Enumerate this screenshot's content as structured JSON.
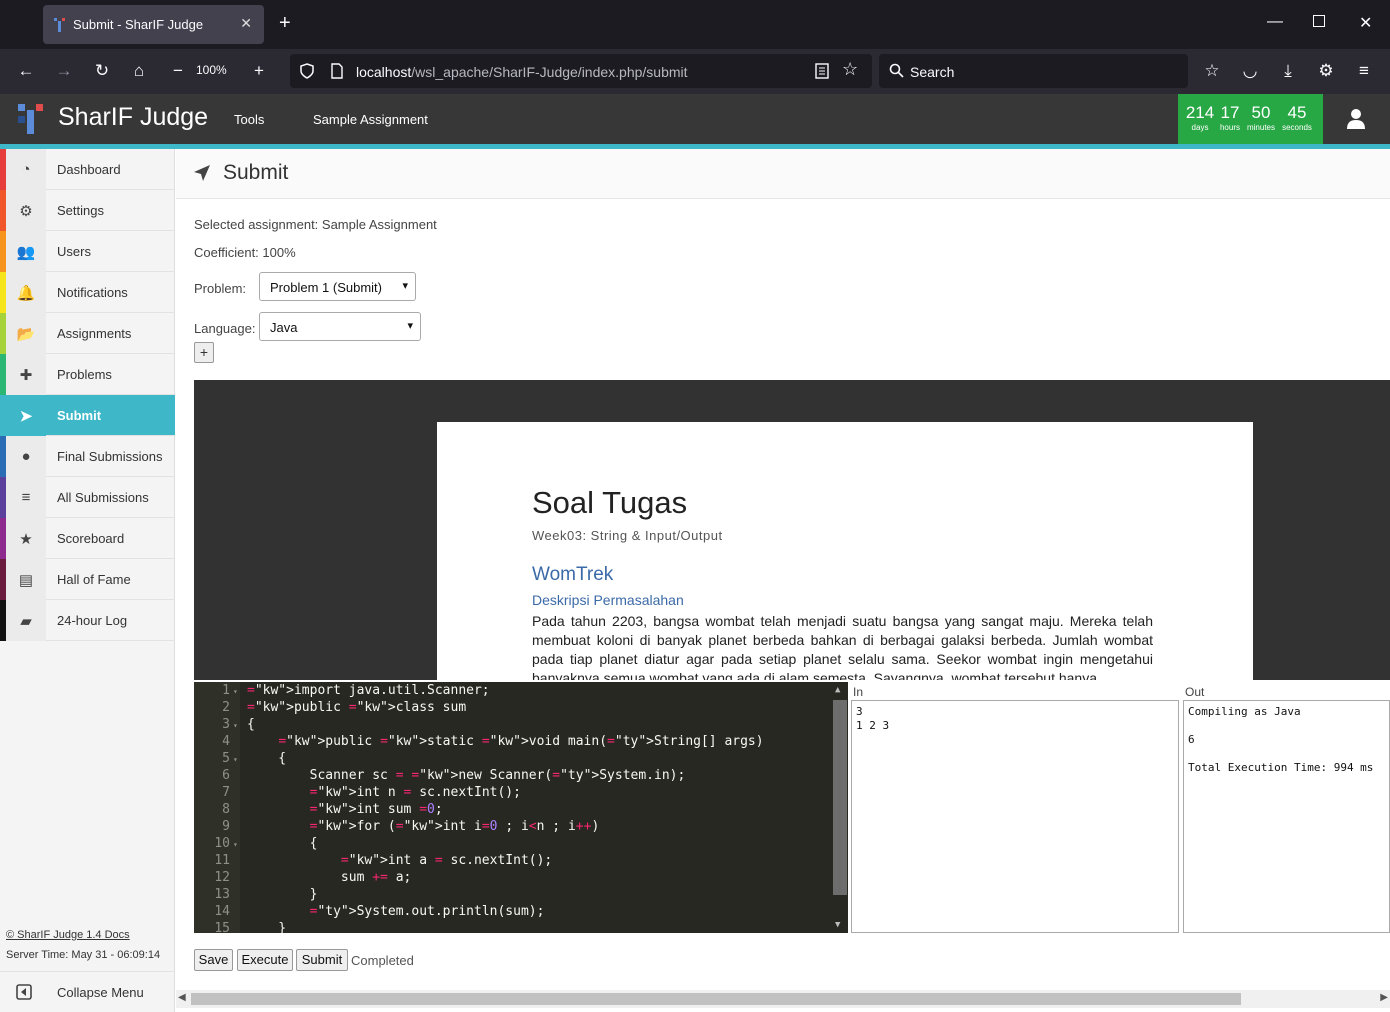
{
  "browser": {
    "tab_title": "Submit - SharIF Judge",
    "zoom": "100%",
    "url_host": "localhost",
    "url_path": "/wsl_apache/SharIF-Judge/index.php/submit",
    "search_placeholder": "Search"
  },
  "header": {
    "brand": "SharIF Judge",
    "nav": [
      "Tools",
      "Sample Assignment"
    ],
    "countdown": [
      {
        "value": "214",
        "unit": "days"
      },
      {
        "value": "17",
        "unit": "hours"
      },
      {
        "value": "50",
        "unit": "minutes"
      },
      {
        "value": "45",
        "unit": "seconds"
      }
    ],
    "accent_color": "#3eb8c9",
    "countdown_color": "#28a745"
  },
  "sidebar": {
    "items": [
      {
        "label": "Dashboard",
        "icon": "dashboard-icon",
        "color": "#e63c3c"
      },
      {
        "label": "Settings",
        "icon": "gear-icon",
        "color": "#f0562a"
      },
      {
        "label": "Users",
        "icon": "users-icon",
        "color": "#f7941d"
      },
      {
        "label": "Notifications",
        "icon": "bell-icon",
        "color": "#f5e51a"
      },
      {
        "label": "Assignments",
        "icon": "folder-icon",
        "color": "#a6d33a"
      },
      {
        "label": "Problems",
        "icon": "puzzle-icon",
        "color": "#2bb673"
      },
      {
        "label": "Submit",
        "icon": "paper-plane-icon",
        "color": "#3eb8c9"
      },
      {
        "label": "Final Submissions",
        "icon": "map-marker-icon",
        "color": "#2a6db5"
      },
      {
        "label": "All Submissions",
        "icon": "list-icon",
        "color": "#5b3f9c"
      },
      {
        "label": "Scoreboard",
        "icon": "star-icon",
        "color": "#8e2a8e"
      },
      {
        "label": "Hall of Fame",
        "icon": "list-alt-icon",
        "color": "#6b1b3c"
      },
      {
        "label": "24-hour Log",
        "icon": "book-icon",
        "color": "#111111"
      }
    ],
    "footer_link": "© SharIF Judge 1.4 Docs",
    "server_time": "Server Time: May 31 - 06:09:14",
    "collapse_label": "Collapse Menu"
  },
  "page": {
    "title": "Submit",
    "selected_assignment": "Selected assignment: Sample Assignment",
    "coefficient": "Coefficient: 100%",
    "problem_label": "Problem:",
    "problem_value": "Problem 1 (Submit)",
    "language_label": "Language:",
    "language_value": "Java",
    "add_button": "+"
  },
  "document": {
    "title": "Soal Tugas",
    "subtitle": "Week03: String & Input/Output",
    "heading": "WomTrek",
    "subheading": "Deskripsi Permasalahan",
    "paragraph": "Pada tahun 2203, bangsa wombat telah menjadi suatu bangsa yang sangat maju. Mereka telah membuat koloni di banyak planet berbeda bahkan di berbagai galaksi berbeda. Jumlah wombat pada tiap planet diatur agar pada setiap planet selalu sama. Seekor wombat ingin mengetahui banyaknya semua wombat yang ada di alam semesta. Sayangnya, wombat tersebut hanya"
  },
  "editor": {
    "line_numbers": [
      "1",
      "2",
      "3",
      "4",
      "5",
      "6",
      "7",
      "8",
      "9",
      "10",
      "11",
      "12",
      "13",
      "14",
      "15"
    ],
    "code_lines": [
      "import java.util.Scanner;",
      "public class sum",
      "{",
      "    public static void main(String[] args)",
      "    {",
      "        Scanner sc = new Scanner(System.in);",
      "        int n = sc.nextInt();",
      "        int sum =0;",
      "        for (int i=0 ; i<n ; i++)",
      "        {",
      "            int a = sc.nextInt();",
      "            sum += a;",
      "        }",
      "        System.out.println(sum);",
      "    }"
    ]
  },
  "io": {
    "in_label": "In",
    "in_text": "3\n1 2 3",
    "out_label": "Out",
    "out_text": "Compiling as Java\n\n6\n\nTotal Execution Time: 994 ms"
  },
  "actions": {
    "save": "Save",
    "execute": "Execute",
    "submit": "Submit",
    "status": "Completed"
  }
}
